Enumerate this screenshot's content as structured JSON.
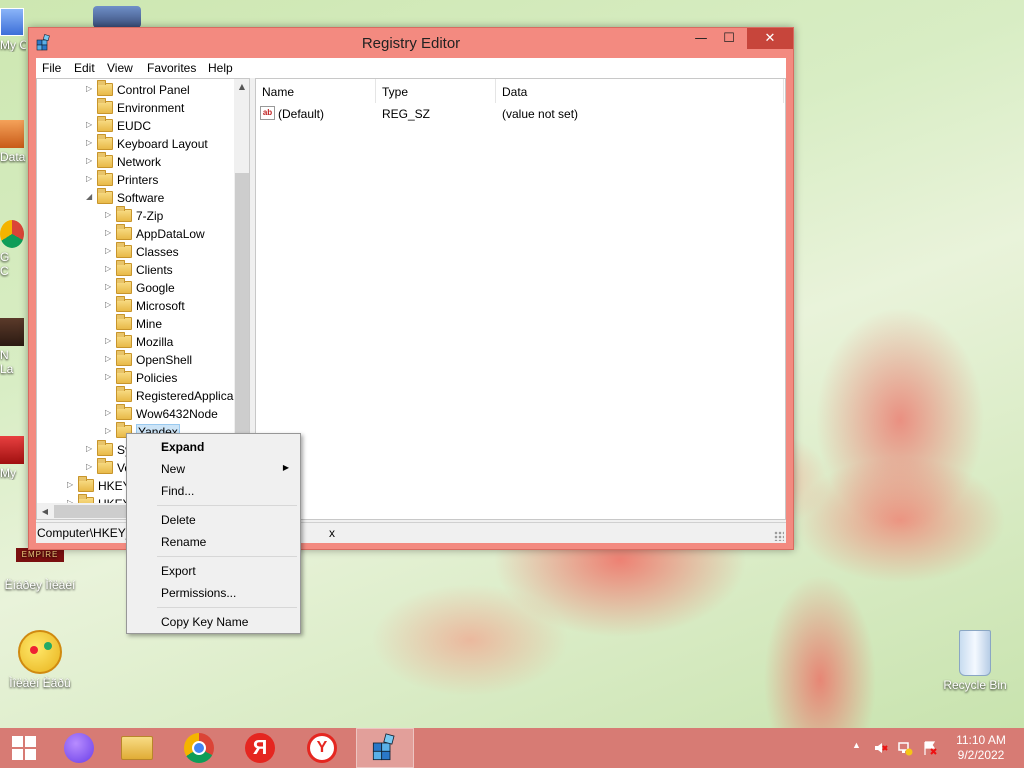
{
  "window": {
    "title": "Registry Editor",
    "minimize_glyph": "—",
    "maximize_glyph": "☐",
    "close_glyph": "✕"
  },
  "menu": [
    "File",
    "Edit",
    "View",
    "Favorites",
    "Help"
  ],
  "tree": {
    "items": [
      {
        "label": "Control Panel",
        "level": 0,
        "expander": "▷"
      },
      {
        "label": "Environment",
        "level": 0,
        "expander": ""
      },
      {
        "label": "EUDC",
        "level": 0,
        "expander": "▷"
      },
      {
        "label": "Keyboard Layout",
        "level": 0,
        "expander": "▷"
      },
      {
        "label": "Network",
        "level": 0,
        "expander": "▷"
      },
      {
        "label": "Printers",
        "level": 0,
        "expander": "▷"
      },
      {
        "label": "Software",
        "level": 0,
        "expander": "◢"
      },
      {
        "label": "7-Zip",
        "level": 1,
        "expander": "▷"
      },
      {
        "label": "AppDataLow",
        "level": 1,
        "expander": "▷"
      },
      {
        "label": "Classes",
        "level": 1,
        "expander": "▷"
      },
      {
        "label": "Clients",
        "level": 1,
        "expander": "▷"
      },
      {
        "label": "Google",
        "level": 1,
        "expander": "▷"
      },
      {
        "label": "Microsoft",
        "level": 1,
        "expander": "▷"
      },
      {
        "label": "Mine",
        "level": 1,
        "expander": ""
      },
      {
        "label": "Mozilla",
        "level": 1,
        "expander": "▷"
      },
      {
        "label": "OpenShell",
        "level": 1,
        "expander": "▷"
      },
      {
        "label": "Policies",
        "level": 1,
        "expander": "▷"
      },
      {
        "label": "RegisteredApplica",
        "level": 1,
        "expander": ""
      },
      {
        "label": "Wow6432Node",
        "level": 1,
        "expander": "▷"
      },
      {
        "label": "Yandex",
        "level": 1,
        "expander": "▷",
        "selected": true
      },
      {
        "label": "Sy",
        "level": 0,
        "expander": "▷"
      },
      {
        "label": "Vo",
        "level": 0,
        "expander": "▷"
      },
      {
        "label": "HKEY",
        "level": -1,
        "expander": "▷"
      },
      {
        "label": "HKEY",
        "level": -1,
        "expander": "▷"
      }
    ]
  },
  "list": {
    "columns": [
      "Name",
      "Type",
      "Data"
    ],
    "rows": [
      {
        "name": "(Default)",
        "type": "REG_SZ",
        "data": "(value not set)",
        "icon": "string-value-icon",
        "icon_text": "ab"
      }
    ]
  },
  "statusbar": {
    "path_start": "Computer\\HKEY_",
    "path_end": "x"
  },
  "context_menu": {
    "items": [
      {
        "label": "Expand",
        "bold": true
      },
      {
        "label": "New",
        "submenu": true
      },
      {
        "label": "Find..."
      },
      {
        "label": "Delete"
      },
      {
        "label": "Rename"
      },
      {
        "label": "Export"
      },
      {
        "label": "Permissions..."
      },
      {
        "label": "Copy Key Name"
      }
    ],
    "submenu_arrow": "▶"
  },
  "desktop": {
    "stubs": [
      "My C",
      "Data",
      "G\nC",
      "N\nLa",
      "My"
    ],
    "icons": [
      {
        "label": "Ëíáðey Ìîëàèí",
        "name": "empire-game-icon"
      },
      {
        "label": "Ìîëàèí Èãðû",
        "name": "games-icon"
      },
      {
        "label": "Recycle Bin",
        "name": "recycle-bin-icon"
      }
    ]
  },
  "taskbar": {
    "clock_time": "11:10 AM",
    "clock_date": "9/2/2022",
    "tray_arrow": "▲",
    "yandex_letter": "Я"
  },
  "colors": {
    "accent": "#f38a80",
    "close": "#c7453b",
    "taskbar": "#d77b74",
    "selection": "#cce4f7"
  }
}
